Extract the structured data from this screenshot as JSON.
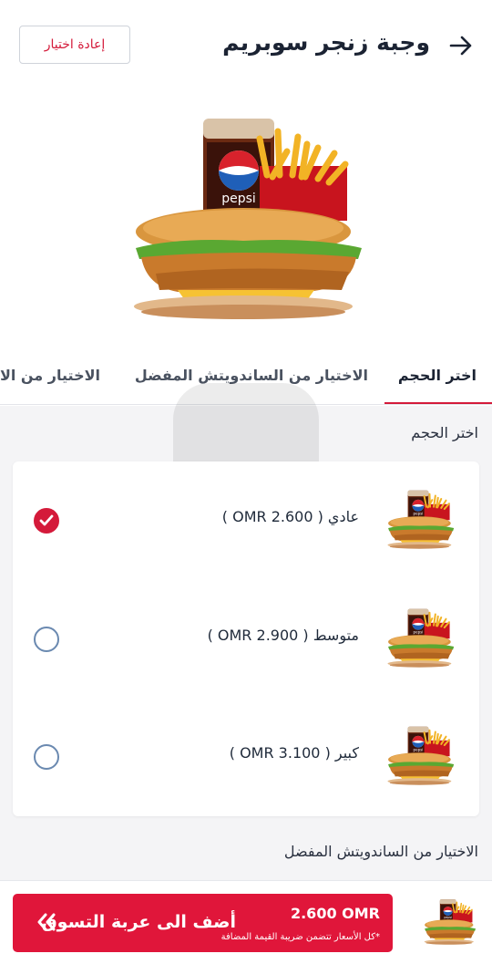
{
  "header": {
    "title": "وجبة زنجر سوبريم",
    "reset_label": "إعادة اختيار",
    "back_icon": "arrow-right-icon"
  },
  "tabs": [
    {
      "label": "اختر الحجم",
      "active": true
    },
    {
      "label": "الاختيار من الساندويتش المفضل",
      "active": false
    },
    {
      "label": "الاختيار من الاخ",
      "active": false
    }
  ],
  "size_section": {
    "title": "اختر الحجم",
    "options": [
      {
        "label": "عادي ( 2.600 OMR )",
        "selected": true
      },
      {
        "label": "متوسط ( 2.900 OMR )",
        "selected": false
      },
      {
        "label": "كبير ( 3.100 OMR )",
        "selected": false
      }
    ]
  },
  "sandwich_section": {
    "title": "الاختيار من الساندويتش المفضل"
  },
  "cart": {
    "price": "2.600 OMR",
    "label": "أضف الى عربة التسوق",
    "note": "*كل الأسعار تتضمن ضريبة القيمة المضافة",
    "icon": "double-chevron-left-icon"
  },
  "colors": {
    "accent": "#e0163a",
    "radio": "#6a89b0"
  }
}
